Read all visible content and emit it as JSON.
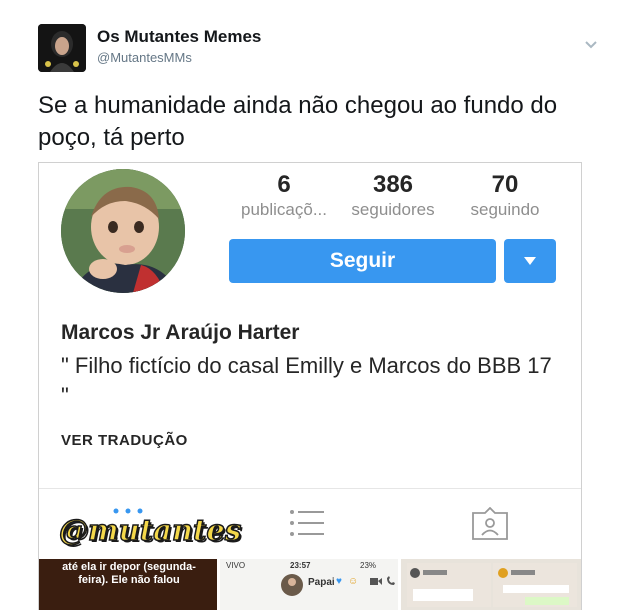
{
  "tweet": {
    "display_name": "Os Mutantes Memes",
    "handle": "@MutantesMMs",
    "text": "Se a humanidade ainda não chegou ao fundo do poço, tá perto"
  },
  "profile": {
    "stats": [
      {
        "value": "6",
        "label": "publicaçõ..."
      },
      {
        "value": "386",
        "label": "seguidores"
      },
      {
        "value": "70",
        "label": "seguindo"
      }
    ],
    "follow_label": "Seguir",
    "name": "Marcos Jr Araújo Harter",
    "bio": "\" Filho fictício do casal Emilly e Marcos do BBB 17 \"",
    "translate_label": "VER TRADUÇÃO"
  },
  "watermark": "@mutantes",
  "thumbs": {
    "story_text": "até ela ir depor (segunda-feira). Ele não falou",
    "chat_carrier": "VIVO",
    "chat_time": "23:57",
    "chat_battery": "23%",
    "chat_contact": "Papai"
  },
  "colors": {
    "accent": "#3897f0",
    "watermark": "#f4d84a"
  }
}
